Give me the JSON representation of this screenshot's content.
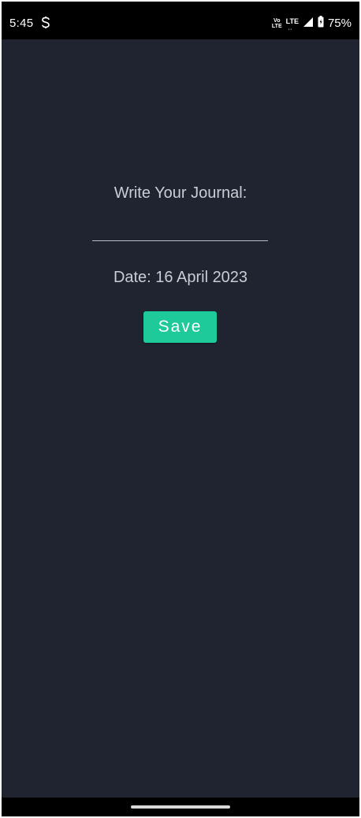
{
  "status_bar": {
    "time": "5:45",
    "volte_top": "Vo",
    "volte_bottom": "LTE",
    "network": "LTE",
    "battery_percent": "75%",
    "icons": [
      "sync-icon",
      "volte-icon",
      "lte-icon",
      "signal-icon",
      "battery-icon"
    ]
  },
  "journal": {
    "label": "Write Your Journal:",
    "input_value": "",
    "date_text": "Date: 16 April 2023",
    "save_label": "Save"
  },
  "colors": {
    "background": "#1f2430",
    "text": "#c9cdd4",
    "accent": "#1ec99a",
    "system_bars": "#000000"
  }
}
